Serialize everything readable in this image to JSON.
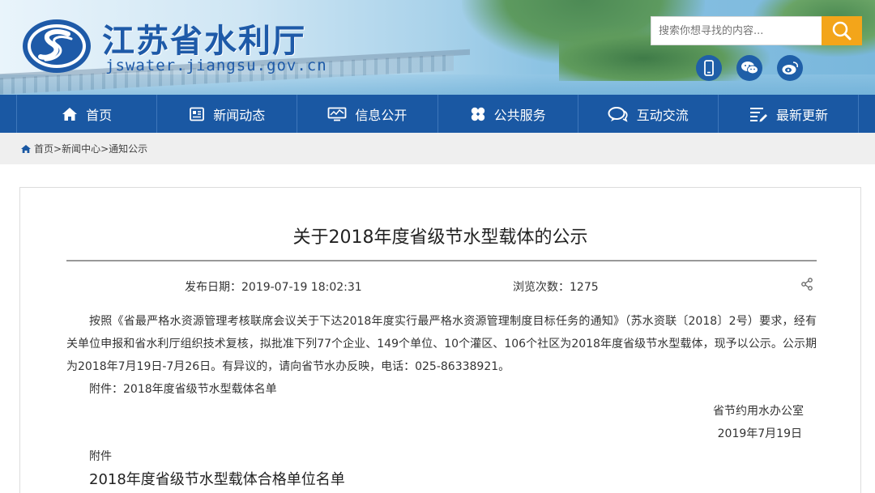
{
  "site": {
    "name_cn": "江苏省水利厅",
    "domain": "jswater.jiangsu.gov.cn"
  },
  "search": {
    "placeholder": "搜索你想寻找的内容..."
  },
  "social": [
    "mobile-icon",
    "wechat-icon",
    "weibo-icon"
  ],
  "nav": {
    "items": [
      {
        "label": "首页",
        "icon": "home-icon"
      },
      {
        "label": "新闻动态",
        "icon": "news-icon"
      },
      {
        "label": "信息公开",
        "icon": "info-icon"
      },
      {
        "label": "公共服务",
        "icon": "service-icon"
      },
      {
        "label": "互动交流",
        "icon": "chat-icon"
      },
      {
        "label": "最新更新",
        "icon": "update-icon"
      }
    ]
  },
  "breadcrumb": {
    "home": "首页>",
    "section": "新闻中心>",
    "current": "通知公示"
  },
  "article": {
    "title": "关于2018年度省级节水型载体的公示",
    "publish_date": "发布日期：2019-07-19 18:02:31",
    "views": "浏览次数：1275",
    "body": "按照《省最严格水资源管理考核联席会议关于下达2018年度实行最严格水资源管理制度目标任务的通知》（苏水资联〔2018〕2号）要求，经有关单位申报和省水利厅组织技术复核，拟批准下列77个企业、149个单位、10个灌区、106个社区为2018年度省级节水型载体，现予以公示。公示期为2018年7月19日-7月26日。有异议的，请向省节水办反映，电话：025-86338921。",
    "attachment_line": "附件：2018年度省级节水型载体名单",
    "signature_office": "省节约用水办公室",
    "signature_date": "2019年7月19日",
    "attachment_label": "附件",
    "list_title": "2018年度省级节水型载体合格单位名单"
  },
  "colors": {
    "nav_bg": "#1a58a3",
    "search_button": "#f3a51a",
    "logo_blue": "#1e5aa8"
  }
}
